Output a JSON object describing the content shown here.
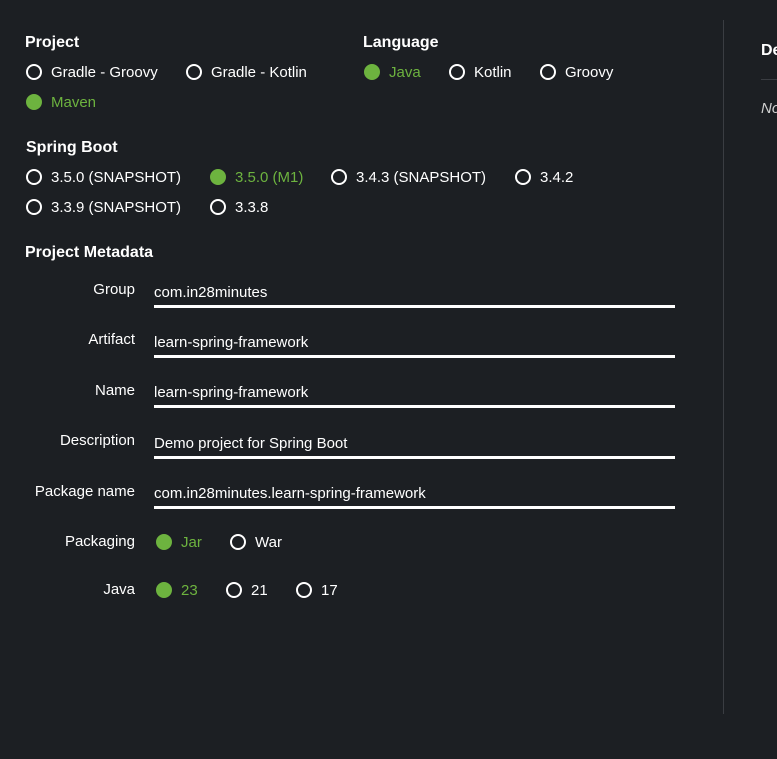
{
  "colors": {
    "background": "#1c1f23",
    "accent": "#6db33f",
    "text": "#ffffff",
    "divider": "#3a3d42"
  },
  "project": {
    "title": "Project",
    "options": [
      {
        "label": "Gradle - Groovy",
        "selected": false
      },
      {
        "label": "Gradle - Kotlin",
        "selected": false
      },
      {
        "label": "Maven",
        "selected": true
      }
    ]
  },
  "language": {
    "title": "Language",
    "options": [
      {
        "label": "Java",
        "selected": true
      },
      {
        "label": "Kotlin",
        "selected": false
      },
      {
        "label": "Groovy",
        "selected": false
      }
    ]
  },
  "spring_boot": {
    "title": "Spring Boot",
    "options": [
      {
        "label": "3.5.0 (SNAPSHOT)",
        "selected": false
      },
      {
        "label": "3.5.0 (M1)",
        "selected": true
      },
      {
        "label": "3.4.3 (SNAPSHOT)",
        "selected": false
      },
      {
        "label": "3.4.2",
        "selected": false
      },
      {
        "label": "3.3.9 (SNAPSHOT)",
        "selected": false
      },
      {
        "label": "3.3.8",
        "selected": false
      }
    ]
  },
  "metadata": {
    "title": "Project Metadata",
    "fields": [
      {
        "label": "Group",
        "value": "com.in28minutes"
      },
      {
        "label": "Artifact",
        "value": "learn-spring-framework"
      },
      {
        "label": "Name",
        "value": "learn-spring-framework"
      },
      {
        "label": "Description",
        "value": "Demo project for Spring Boot"
      },
      {
        "label": "Package name",
        "value": "com.in28minutes.learn-spring-framework"
      }
    ],
    "packaging": {
      "label": "Packaging",
      "options": [
        {
          "label": "Jar",
          "selected": true
        },
        {
          "label": "War",
          "selected": false
        }
      ]
    },
    "java": {
      "label": "Java",
      "options": [
        {
          "label": "23",
          "selected": true
        },
        {
          "label": "21",
          "selected": false
        },
        {
          "label": "17",
          "selected": false
        }
      ]
    }
  },
  "dependencies": {
    "title": "De",
    "note": "No"
  }
}
